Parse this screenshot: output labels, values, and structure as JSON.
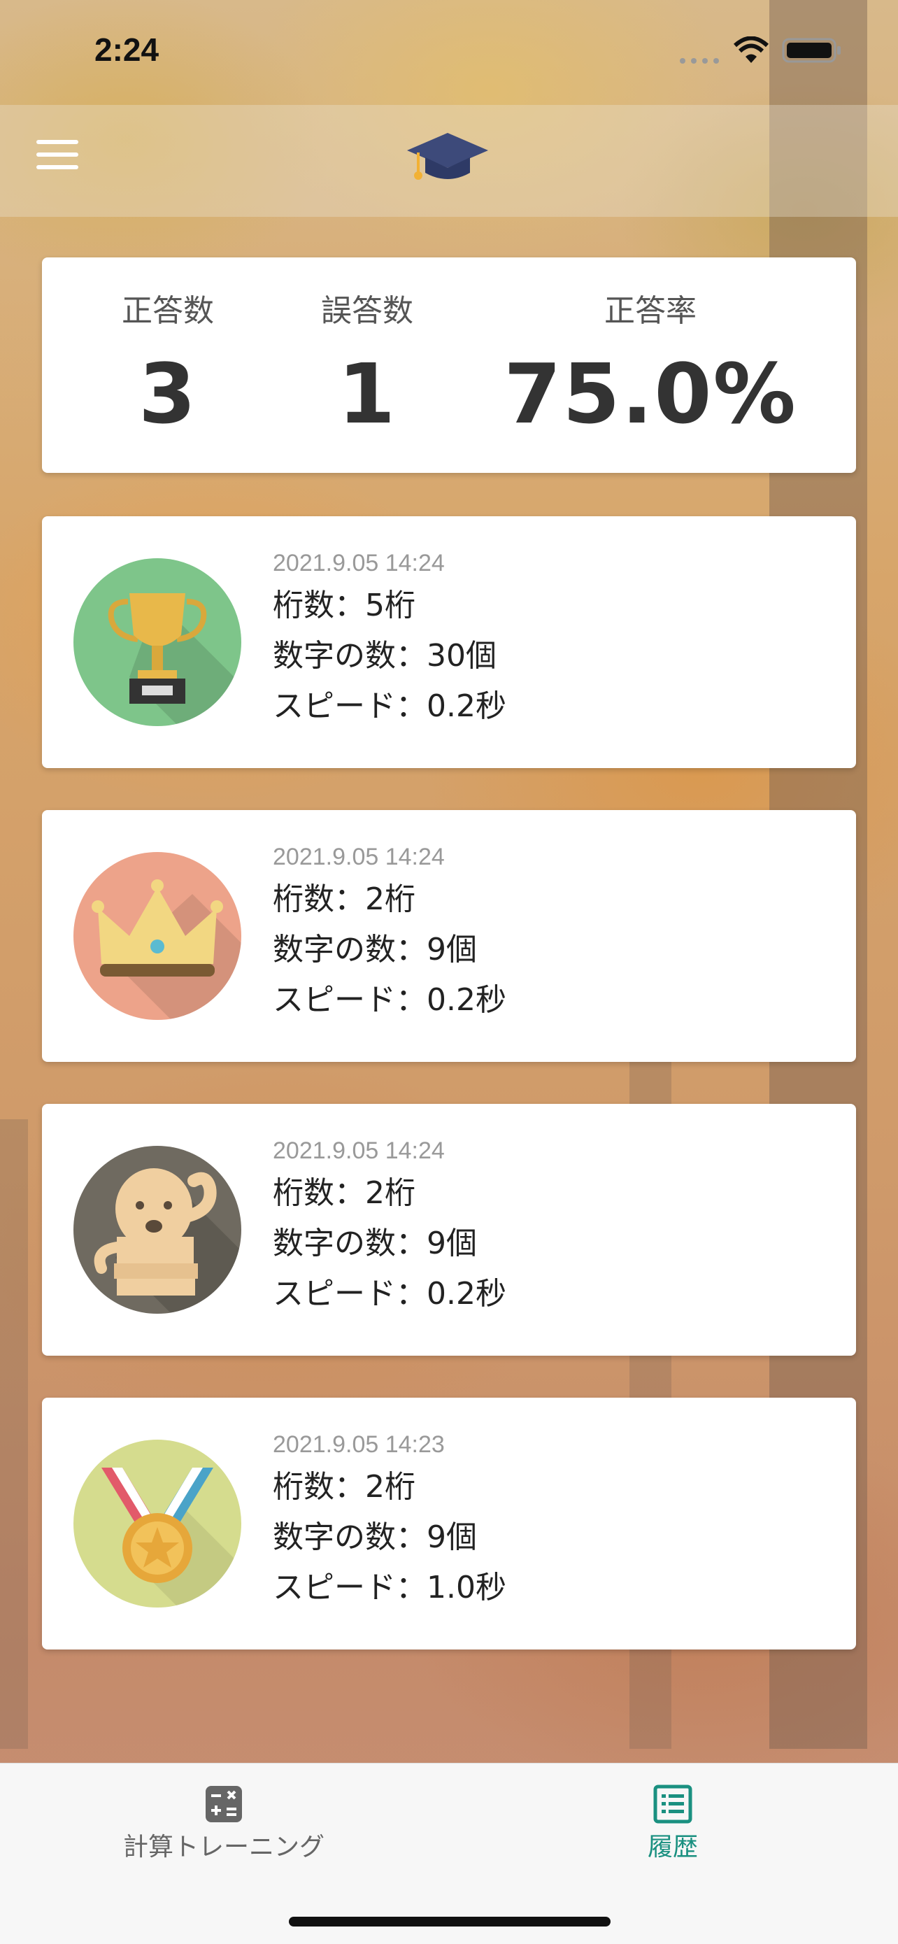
{
  "status": {
    "time": "2:24"
  },
  "summary": {
    "correct_label": "正答数",
    "correct_value": "3",
    "wrong_label": "誤答数",
    "wrong_value": "1",
    "rate_label": "正答率",
    "rate_value": "75.0%"
  },
  "history": [
    {
      "badge": "trophy-icon",
      "date": "2021.9.05 14:24",
      "digits": "桁数：5桁",
      "count": "数字の数：30個",
      "speed": "スピード：0.2秒"
    },
    {
      "badge": "crown-icon",
      "date": "2021.9.05 14:24",
      "digits": "桁数：2桁",
      "count": "数字の数：9個",
      "speed": "スピード：0.2秒"
    },
    {
      "badge": "statue-icon",
      "date": "2021.9.05 14:24",
      "digits": "桁数：2桁",
      "count": "数字の数：9個",
      "speed": "スピード：0.2秒"
    },
    {
      "badge": "medal-icon",
      "date": "2021.9.05 14:23",
      "digits": "桁数：2桁",
      "count": "数字の数：9個",
      "speed": "スピード：1.0秒"
    }
  ],
  "tabs": [
    {
      "label": "計算トレーニング",
      "icon": "calculator-icon",
      "active": false
    },
    {
      "label": "履歴",
      "icon": "list-icon",
      "active": true
    }
  ],
  "colors": {
    "active_tab": "#1a9080",
    "inactive_tab": "#666666"
  }
}
